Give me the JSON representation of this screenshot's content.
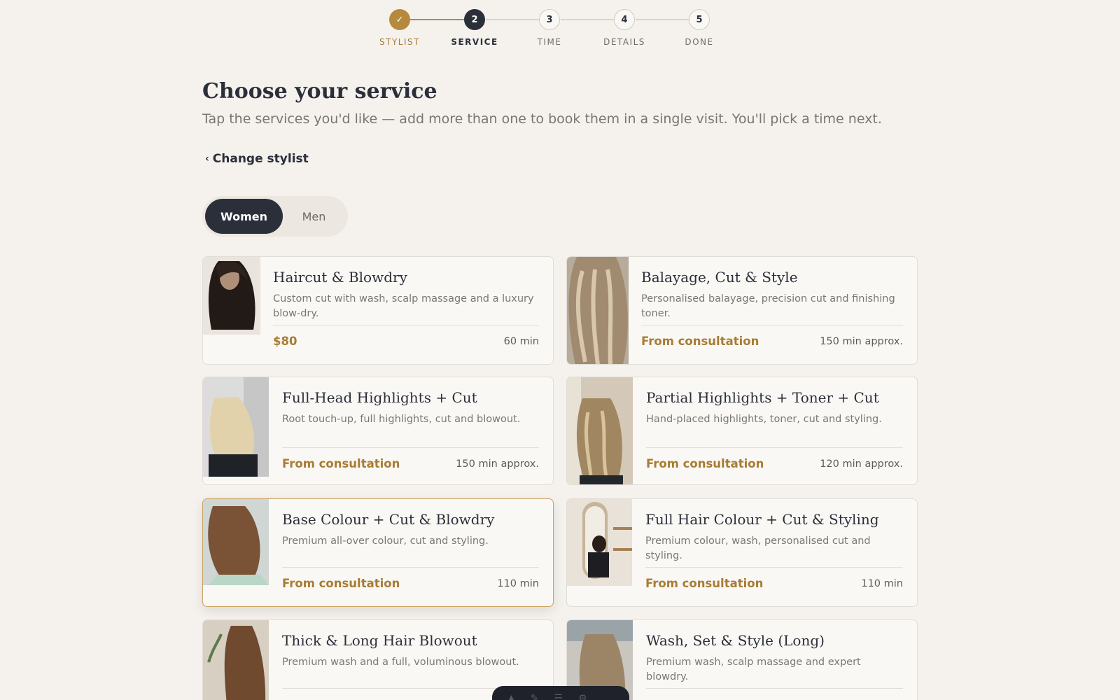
{
  "steps": [
    {
      "number": "✓",
      "label": "STYLIST",
      "state": "done"
    },
    {
      "number": "2",
      "label": "SERVICE",
      "state": "active"
    },
    {
      "number": "3",
      "label": "TIME",
      "state": "todo"
    },
    {
      "number": "4",
      "label": "DETAILS",
      "state": "todo"
    },
    {
      "number": "5",
      "label": "DONE",
      "state": "todo"
    }
  ],
  "page": {
    "title": "Choose your service",
    "subtitle": "Tap the services you'd like — add more than one to book them in a single visit. You'll pick a time next."
  },
  "back_link": {
    "chevron": "‹",
    "label": "Change stylist"
  },
  "segment": {
    "options": [
      "Women",
      "Men"
    ],
    "selected": "Women"
  },
  "services": [
    {
      "title": "Haircut & Blowdry",
      "description": "Custom cut with wash, scalp massage and a luxury blow-dry.",
      "price": "$80",
      "duration": "60 min",
      "selected": false
    },
    {
      "title": "Balayage, Cut & Style",
      "description": "Personalised balayage, precision cut and finishing toner.",
      "price": "From consultation",
      "duration": "150 min approx.",
      "selected": false
    },
    {
      "title": "Full-Head Highlights + Cut",
      "description": "Root touch-up, full highlights, cut and blowout.",
      "price": "From consultation",
      "duration": "150 min approx.",
      "selected": false
    },
    {
      "title": "Partial Highlights + Toner + Cut",
      "description": "Hand-placed highlights, toner, cut and styling.",
      "price": "From consultation",
      "duration": "120 min approx.",
      "selected": false
    },
    {
      "title": "Base Colour + Cut & Blowdry",
      "description": "Premium all-over colour, cut and styling.",
      "price": "From consultation",
      "duration": "110 min",
      "selected": true
    },
    {
      "title": "Full Hair Colour + Cut & Styling",
      "description": "Premium colour, wash, personalised cut and styling.",
      "price": "From consultation",
      "duration": "110 min",
      "selected": false
    },
    {
      "title": "Thick & Long Hair Blowout",
      "description": "Premium wash and a full, voluminous blowout.",
      "price": "",
      "duration": "",
      "selected": false
    },
    {
      "title": "Wash, Set & Style (Long)",
      "description": "Premium wash, scalp massage and expert blowdry.",
      "price": "",
      "duration": "",
      "selected": false
    }
  ],
  "colors": {
    "accent": "#b58a3c",
    "dark": "#2b2f3a",
    "background": "#f5f2ed",
    "card": "#faf8f4"
  }
}
